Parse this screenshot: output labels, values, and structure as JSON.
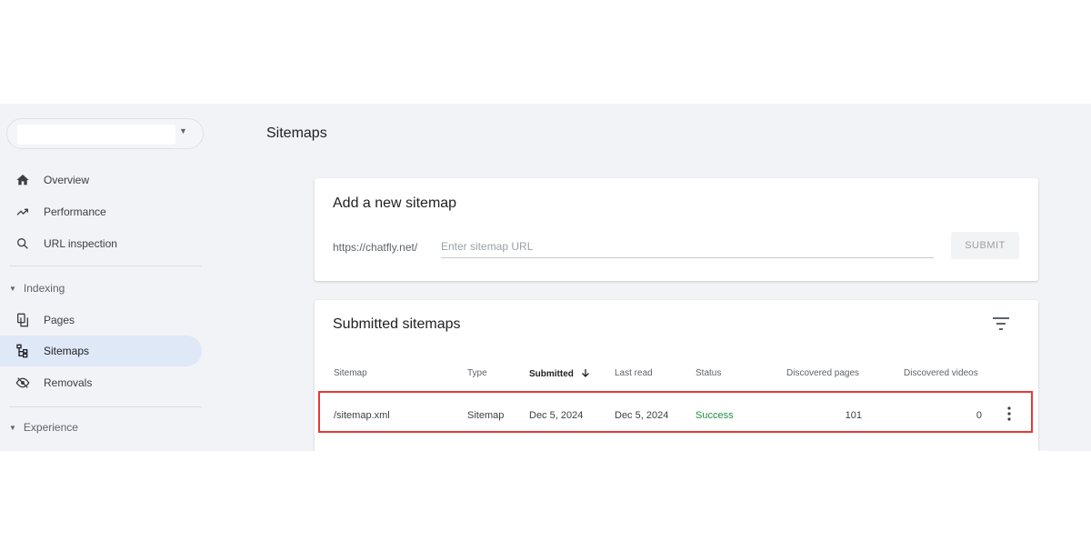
{
  "sidebar": {
    "property": {
      "value": ""
    },
    "items_top": [
      {
        "label": "Overview",
        "icon": "home-icon"
      },
      {
        "label": "Performance",
        "icon": "trending-up-icon"
      },
      {
        "label": "URL inspection",
        "icon": "search-icon"
      }
    ],
    "indexing": {
      "label": "Indexing",
      "items": [
        {
          "label": "Pages",
          "icon": "pages-icon"
        },
        {
          "label": "Sitemaps",
          "icon": "sitemap-icon",
          "active": true
        },
        {
          "label": "Removals",
          "icon": "removals-icon"
        }
      ]
    },
    "experience": {
      "label": "Experience"
    }
  },
  "main": {
    "title": "Sitemaps",
    "add_card": {
      "title": "Add a new sitemap",
      "url_prefix": "https://chatfly.net/",
      "input_placeholder": "Enter sitemap URL",
      "input_value": "",
      "submit_label": "SUBMIT"
    },
    "submitted_card": {
      "title": "Submitted sitemaps",
      "columns": [
        "Sitemap",
        "Type",
        "Submitted",
        "Last read",
        "Status",
        "Discovered pages",
        "Discovered videos"
      ],
      "sorted_column": "Submitted",
      "sort_direction": "descending",
      "rows": [
        {
          "sitemap": "/sitemap.xml",
          "type": "Sitemap",
          "submitted": "Dec 5, 2024",
          "last_read": "Dec 5, 2024",
          "status": "Success",
          "discovered_pages": "101",
          "discovered_videos": "0"
        }
      ]
    }
  },
  "colors": {
    "background": "#f1f3f7",
    "active_nav": "#dfe8f7",
    "success": "#1e8e3e",
    "highlight_border": "#e53935"
  }
}
